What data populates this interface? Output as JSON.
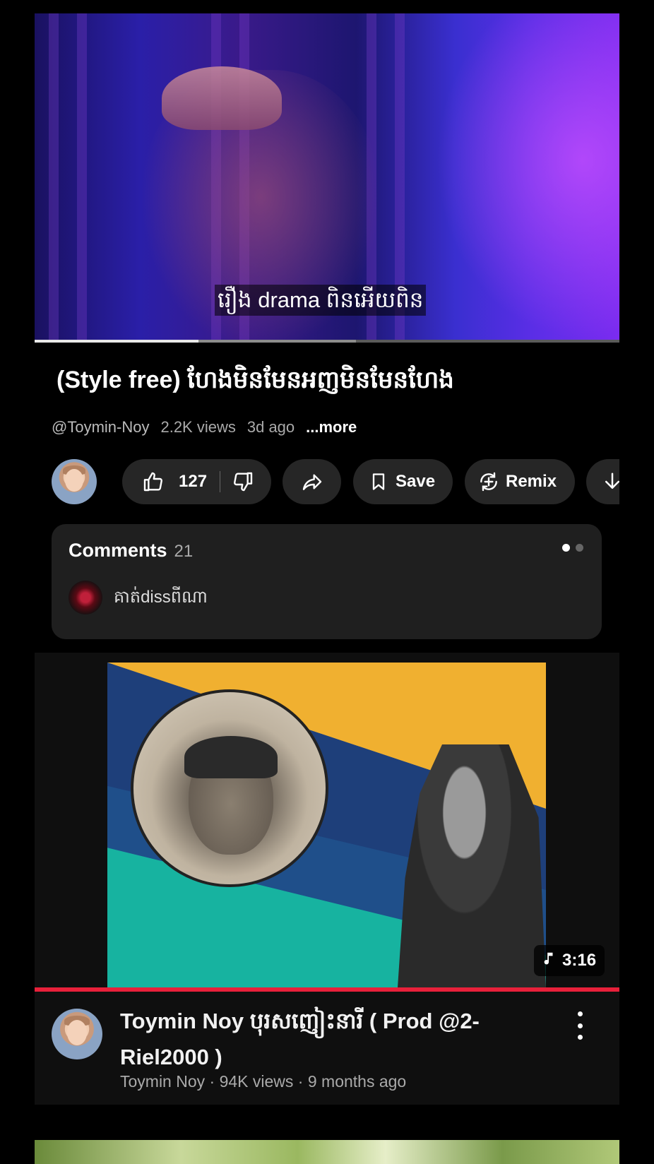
{
  "player": {
    "subtitle": "រឿង drama ពិនអើយពិន",
    "progress_fraction": 0.28,
    "buffer_fraction": 0.55
  },
  "video": {
    "title": "(Style free) ហែងមិនមែនអញមិនមែនហែង",
    "channel": "@Toymin-Noy",
    "views": "2.2K views",
    "age": "3d ago",
    "more": "...more"
  },
  "actions": {
    "like_count": "127",
    "save_label": "Save",
    "remix_label": "Remix"
  },
  "comments": {
    "label": "Comments",
    "count": "21",
    "top_comment": "គាត់dissពីណា"
  },
  "next_video": {
    "duration": "3:16",
    "title": "Toymin Noy  បុរសញៀះនារី ( Prod  @2-Riel2000  )",
    "meta": "Toymin Noy · 94K views · 9 months ago",
    "progress_fraction": 1.0
  },
  "colors": {
    "background": "#000000",
    "pill": "#262626",
    "card": "#1f1f1f",
    "accent_red": "#e8203a"
  },
  "icons": [
    "like-icon",
    "dislike-icon",
    "share-icon",
    "save-icon",
    "remix-icon",
    "download-icon",
    "music-note-icon",
    "more-vert-icon"
  ]
}
